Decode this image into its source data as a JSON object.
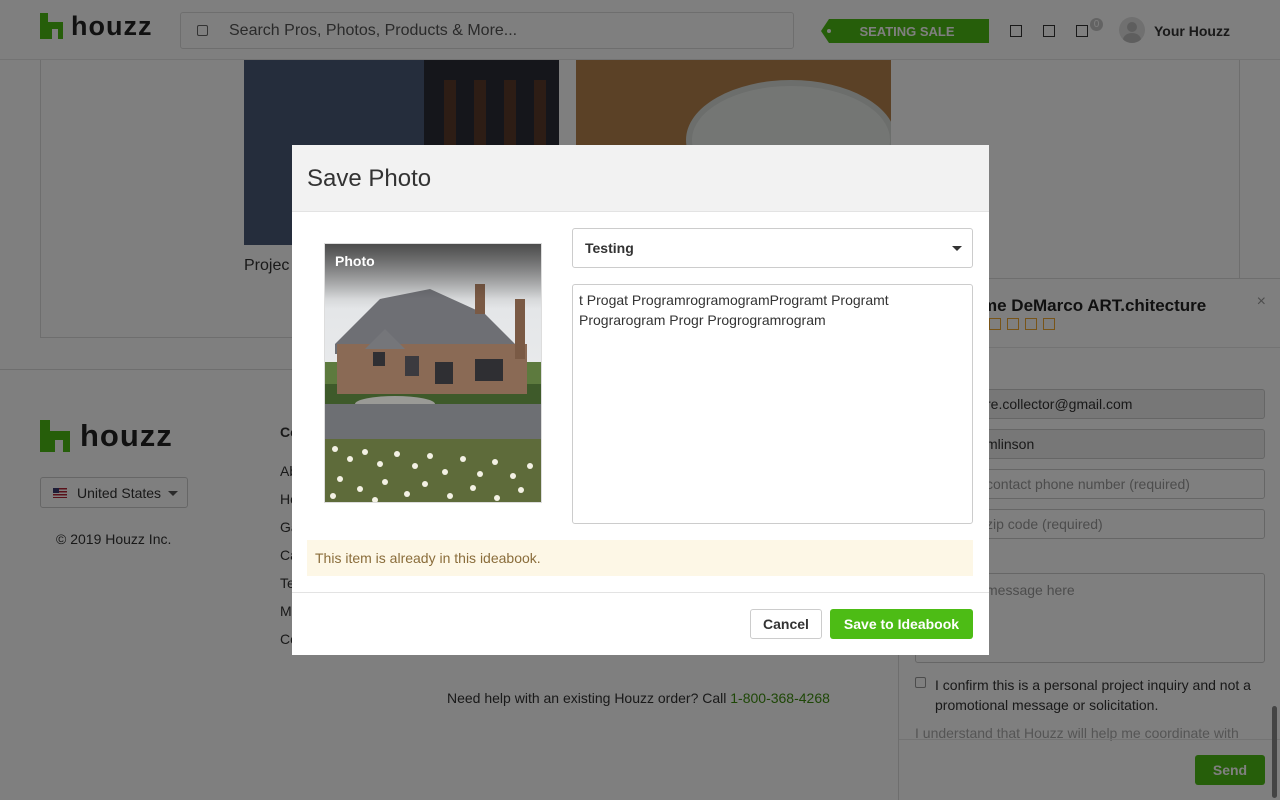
{
  "header": {
    "logo_text": "houzz",
    "search_placeholder": "Search Pros, Photos, Products & More...",
    "sale_label": "SEATING SALE",
    "cart_count": "0",
    "user_label": "Your Houzz"
  },
  "background": {
    "project_text": "Projec",
    "footer_logo_text": "houzz",
    "country_label": "United States",
    "copyright": "© 2019 Houzz Inc.",
    "footer_links": [
      "Co",
      "Ab",
      "Ho",
      "Ga",
      "Ca",
      "Te",
      "M",
      "Co"
    ],
    "help_text": "Need help with an existing Houzz order? Call ",
    "help_phone": "1-800-368-4268"
  },
  "contact_panel": {
    "name": "rome DeMarco ART.chitecture",
    "email_value": "re.collector@gmail.com",
    "name_value": "mlinson",
    "phone_placeholder": "contact phone number (required)",
    "zip_placeholder": "zip code (required)",
    "message_placeholder": "message here",
    "confirm_label": "I confirm this is a personal project inquiry and not a promotional message or solicitation.",
    "understand_text": "I understand that Houzz will help me coordinate with",
    "send_label": "Send",
    "close_glyph": "×"
  },
  "modal": {
    "title": "Save Photo",
    "photo_label": "Photo",
    "ideabook_selected": "Testing",
    "description_value": "t Progat ProgramrogramogramProgramt Programt Prograrogram Progr Progrogramrogram",
    "notice": "This item is already in this ideabook.",
    "cancel_label": "Cancel",
    "save_label": "Save to Ideabook"
  },
  "colors": {
    "brand_green": "#4dbc15",
    "notice_bg": "#fdf7e6",
    "notice_text": "#8a6d3b",
    "link_green": "#3d8f0e"
  },
  "icons": [
    "houzz-logo-icon",
    "search-icon",
    "bookmark-icon",
    "message-icon",
    "cart-icon",
    "avatar-icon",
    "close-icon",
    "star-icon",
    "flag-icon",
    "chevron-down-icon"
  ]
}
